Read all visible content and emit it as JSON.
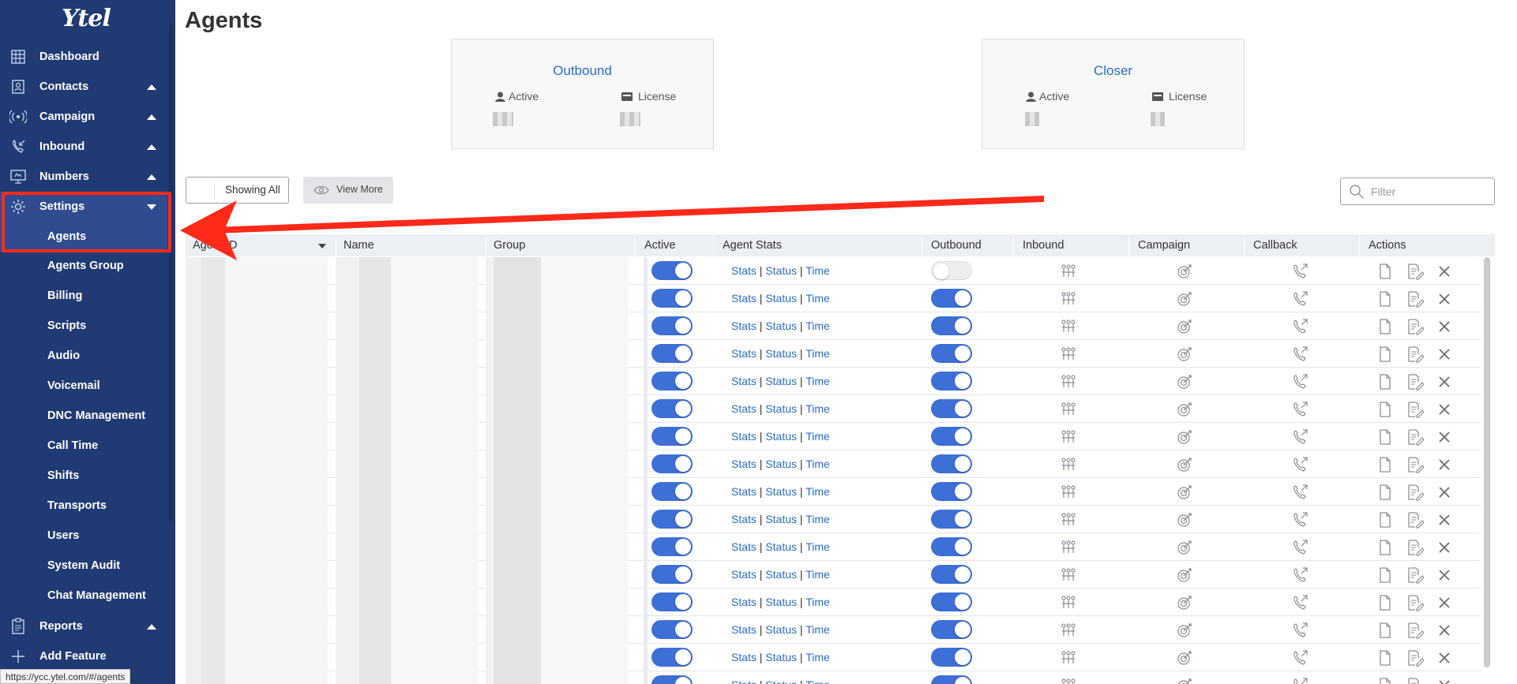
{
  "app": {
    "logo": "Ytel"
  },
  "sidebar": {
    "items": [
      {
        "label": "Dashboard",
        "icon": "dashboard-icon",
        "caret": ""
      },
      {
        "label": "Contacts",
        "icon": "contacts-icon",
        "caret": "up"
      },
      {
        "label": "Campaign",
        "icon": "campaign-icon",
        "caret": "up"
      },
      {
        "label": "Inbound",
        "icon": "inbound-icon",
        "caret": "up"
      },
      {
        "label": "Numbers",
        "icon": "numbers-icon",
        "caret": "up"
      },
      {
        "label": "Settings",
        "icon": "gear-icon",
        "caret": "down"
      }
    ],
    "settings_sub": [
      "Agents",
      "Agents Group",
      "Billing",
      "Scripts",
      "Audio",
      "Voicemail",
      "DNC Management",
      "Call Time",
      "Shifts",
      "Transports",
      "Users",
      "System Audit",
      "Chat Management"
    ],
    "reports": "Reports",
    "add_feature": "Add Feature"
  },
  "status_url": "https://ycc.ytel.com/#/agents",
  "page": {
    "title": "Agents"
  },
  "cards": [
    {
      "title": "Outbound",
      "active_label": "Active",
      "license_label": "License"
    },
    {
      "title": "Closer",
      "active_label": "Active",
      "license_label": "License"
    }
  ],
  "toolbar": {
    "showing_all": "Showing All",
    "view_more": "View More",
    "filter_placeholder": "Filter"
  },
  "table": {
    "headers": [
      "Agent ID",
      "Name",
      "Group",
      "Active",
      "Agent Stats",
      "Outbound",
      "Inbound",
      "Campaign",
      "Callback",
      "Actions"
    ],
    "link_stats": "Stats",
    "link_status": "Status",
    "link_time": "Time",
    "separator": "|",
    "rows": [
      {
        "active": true,
        "outbound": false
      },
      {
        "active": true,
        "outbound": true
      },
      {
        "active": true,
        "outbound": true
      },
      {
        "active": true,
        "outbound": true
      },
      {
        "active": true,
        "outbound": true
      },
      {
        "active": true,
        "outbound": true
      },
      {
        "active": true,
        "outbound": true
      },
      {
        "active": true,
        "outbound": true
      },
      {
        "active": true,
        "outbound": true
      },
      {
        "active": true,
        "outbound": true
      },
      {
        "active": true,
        "outbound": true
      },
      {
        "active": true,
        "outbound": true
      },
      {
        "active": true,
        "outbound": true
      },
      {
        "active": true,
        "outbound": true
      },
      {
        "active": true,
        "outbound": true
      },
      {
        "active": true,
        "outbound": true
      }
    ]
  },
  "colors": {
    "sidebar_bg": "#203a73",
    "accent": "#3d6fd6",
    "link": "#2a6dc7",
    "annotation": "#ff2a1a"
  }
}
